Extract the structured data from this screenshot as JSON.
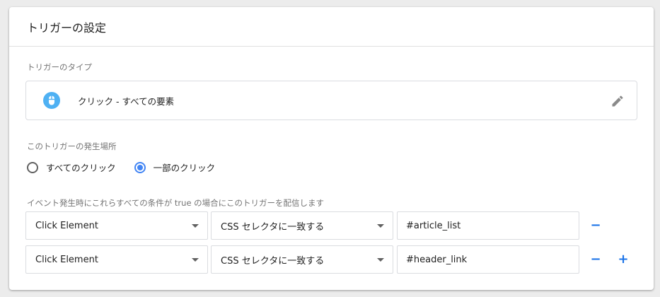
{
  "header": {
    "title": "トリガーの設定"
  },
  "trigger_type": {
    "label": "トリガーのタイプ",
    "value": "クリック - すべての要素",
    "icon": "mouse-icon",
    "icon_color": "#4fb1f3"
  },
  "fire_on": {
    "label": "このトリガーの発生場所",
    "options": [
      {
        "label": "すべてのクリック",
        "checked": false
      },
      {
        "label": "一部のクリック",
        "checked": true
      }
    ]
  },
  "conditions": {
    "label": "イベント発生時にこれらすべての条件が true の場合にこのトリガーを配信します",
    "rows": [
      {
        "variable": "Click Element",
        "operator": "CSS セレクタに一致する",
        "value": "#article_list",
        "remove_label": "−"
      },
      {
        "variable": "Click Element",
        "operator": "CSS セレクタに一致する",
        "value": "#header_link",
        "remove_label": "−",
        "add_label": "+"
      }
    ]
  },
  "colors": {
    "accent": "#4285f4",
    "link": "#1a73e8"
  }
}
